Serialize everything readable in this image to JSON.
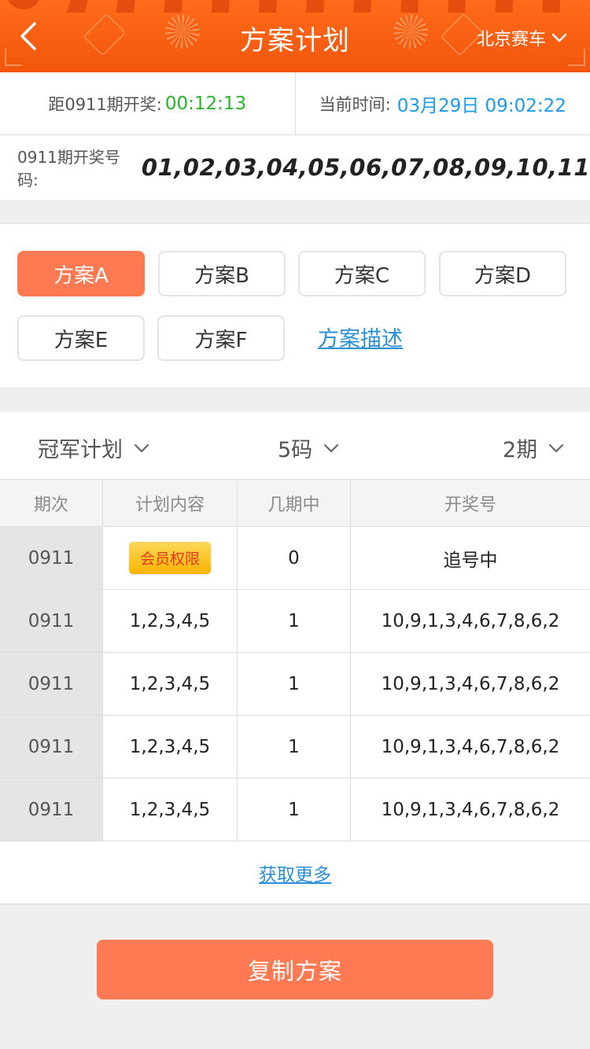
{
  "header": {
    "title": "方案计划",
    "region": "北京赛车",
    "back_icon": "chevron-left-icon",
    "dropdown_icon": "chevron-down-icon",
    "color": "#f2560c"
  },
  "countdown": {
    "label": "距0911期开奖:",
    "value": "00:12:13",
    "color": "#27b52a"
  },
  "current_time": {
    "label": "当前时间:",
    "value": "03月29日 09:02:22",
    "color": "#1a9bf0"
  },
  "result": {
    "label": "0911期开奖号码:",
    "numbers": "01,02,03,04,05,06,07,08,09,10,11"
  },
  "plans": {
    "items": [
      "方案A",
      "方案B",
      "方案C",
      "方案D",
      "方案E",
      "方案F"
    ],
    "active_index": 0,
    "description_link": "方案描述",
    "accent": "#ff7a52"
  },
  "filters": {
    "type": "冠军计划",
    "codes": "5码",
    "periods": "2期"
  },
  "table": {
    "headers": [
      "期次",
      "计划内容",
      "几期中",
      "开奖号"
    ],
    "rows": [
      {
        "period": "0911",
        "plan": "会员权限",
        "plan_is_badge": true,
        "hit": "0",
        "draw": "追号中"
      },
      {
        "period": "0911",
        "plan": "1,2,3,4,5",
        "plan_is_badge": false,
        "hit": "1",
        "draw": "10,9,1,3,4,6,7,8,6,2"
      },
      {
        "period": "0911",
        "plan": "1,2,3,4,5",
        "plan_is_badge": false,
        "hit": "1",
        "draw": "10,9,1,3,4,6,7,8,6,2"
      },
      {
        "period": "0911",
        "plan": "1,2,3,4,5",
        "plan_is_badge": false,
        "hit": "1",
        "draw": "10,9,1,3,4,6,7,8,6,2"
      },
      {
        "period": "0911",
        "plan": "1,2,3,4,5",
        "plan_is_badge": false,
        "hit": "1",
        "draw": "10,9,1,3,4,6,7,8,6,2"
      }
    ]
  },
  "more_link": "获取更多",
  "copy_button": "复制方案"
}
